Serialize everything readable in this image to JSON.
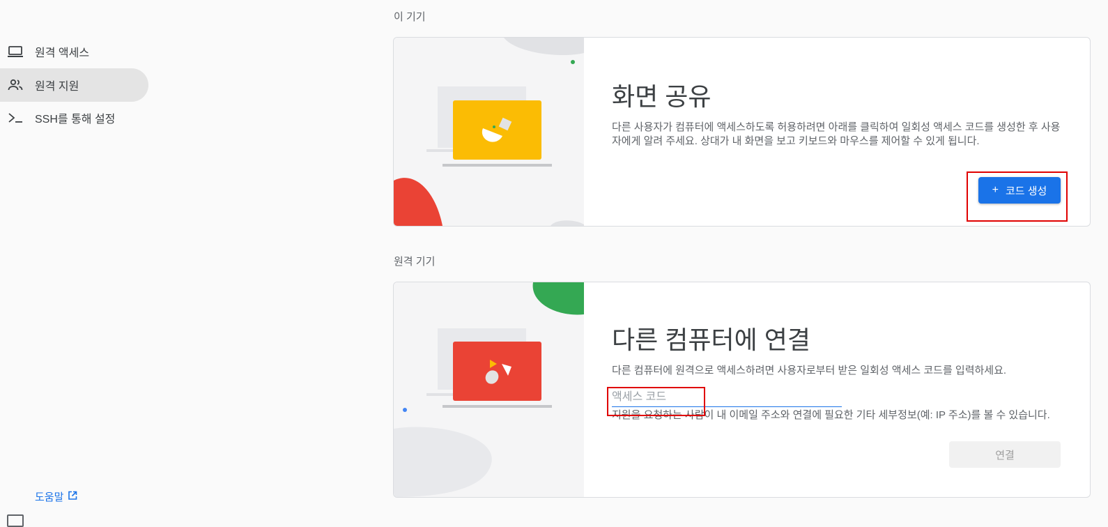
{
  "sidebar": {
    "items": [
      {
        "label": "원격 액세스",
        "icon": "laptop-icon",
        "active": false
      },
      {
        "label": "원격 지원",
        "icon": "people-icon",
        "active": true
      },
      {
        "label": "SSH를 통해 설정",
        "icon": "terminal-icon",
        "active": false
      }
    ],
    "help": {
      "label": "도움말",
      "icon": "open-in-new-icon"
    }
  },
  "this_device": {
    "section_label": "이 기기",
    "title": "화면 공유",
    "description": "다른 사용자가 컴퓨터에 액세스하도록 허용하려면 아래를 클릭하여 일회성 액세스 코드를 생성한 후 사용자에게 알려 주세요. 상대가 내 화면을 보고 키보드와 마우스를 제어할 수 있게 됩니다.",
    "button": {
      "icon": "+",
      "label": "코드 생성"
    },
    "illustration_color": "#fbbc04"
  },
  "remote_device": {
    "section_label": "원격 기기",
    "title": "다른 컴퓨터에 연결",
    "description": "다른 컴퓨터에 원격으로 액세스하려면 사용자로부터 받은 일회성 액세스 코드를 입력하세요.",
    "input": {
      "placeholder": "액세스 코드",
      "value": ""
    },
    "notice": "지원을 요청하는 사람이 내 이메일 주소와 연결에 필요한 기타 세부정보(예: IP 주소)를 볼 수 있습니다.",
    "button": {
      "label": "연결",
      "disabled": true
    },
    "illustration_color": "#ea4335"
  },
  "colors": {
    "accent": "#1a73e8",
    "highlight": "#e00000",
    "green": "#34a853",
    "red": "#ea4335",
    "yellow": "#fbbc04"
  }
}
